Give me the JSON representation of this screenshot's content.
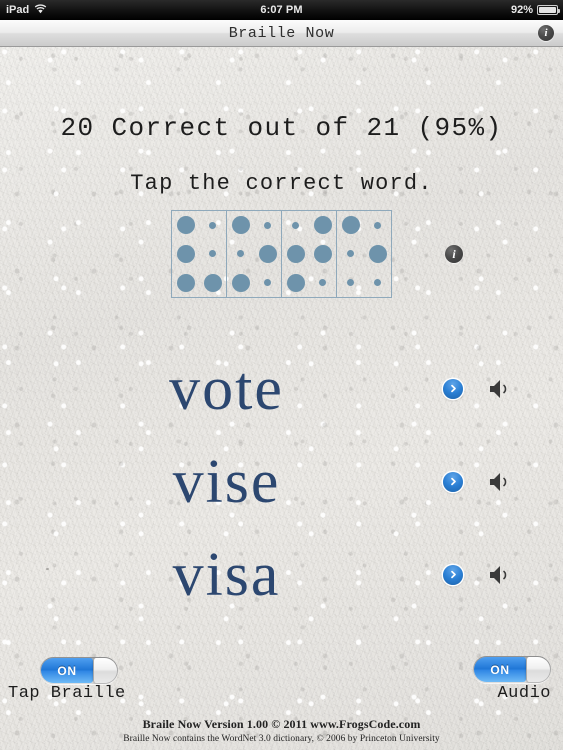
{
  "status_bar": {
    "carrier": "iPad",
    "wifi_icon": "wifi-icon",
    "time": "6:07 PM",
    "battery_percent": "92%",
    "battery_icon": "battery-icon"
  },
  "nav_bar": {
    "title": "Braille Now",
    "info_icon": "info-icon"
  },
  "main": {
    "score_text": "20 Correct out of 21 (95%)",
    "score_correct": 20,
    "score_total": 21,
    "score_percent": "95%",
    "prompt": "Tap the correct word.",
    "braille": {
      "word": "vote",
      "info_icon": "info-icon",
      "dot_color": "#6e93ab",
      "cell_border_color": "#8fa9bb",
      "cells": [
        {
          "letter": "v",
          "dots": [
            1,
            1,
            0,
            1,
            0,
            1,
            1,
            1
          ]
        },
        {
          "letter": "o",
          "dots": [
            1,
            0,
            0,
            1,
            1,
            0
          ]
        },
        {
          "letter": "t",
          "dots": [
            0,
            1,
            1,
            1,
            1,
            0
          ]
        },
        {
          "letter": "e",
          "dots": [
            1,
            0,
            0,
            1,
            0,
            0
          ]
        }
      ],
      "cells_detail": [
        {
          "letter": "v",
          "raised": [
            1,
            2,
            3,
            6
          ]
        },
        {
          "letter": "o",
          "raised": [
            1,
            3,
            5
          ]
        },
        {
          "letter": "t",
          "raised": [
            2,
            3,
            4,
            5
          ]
        },
        {
          "letter": "e",
          "raised": [
            1,
            5
          ]
        }
      ]
    },
    "choices": [
      {
        "word": "vote",
        "detail_icon": "chevron-right-icon",
        "audio_icon": "speaker-icon"
      },
      {
        "word": "vise",
        "detail_icon": "chevron-right-icon",
        "audio_icon": "speaker-icon"
      },
      {
        "word": "visa",
        "detail_icon": "chevron-right-icon",
        "audio_icon": "speaker-icon"
      }
    ]
  },
  "controls": {
    "tap_braille": {
      "label": "Tap Braille",
      "state": "ON"
    },
    "audio": {
      "label": "Audio",
      "state": "ON"
    }
  },
  "footer": {
    "line1": "Braile Now Version 1.00 © 2011 www.FrogsCode.com",
    "line2": "Braille Now contains the WordNet 3.0 dictionary, © 2006 by Princeton University"
  },
  "colors": {
    "word_blue": "#2c4770",
    "braille_dot": "#6e93ab",
    "toggle_on": "#2f86e4",
    "paper": "#e8e6e2"
  }
}
